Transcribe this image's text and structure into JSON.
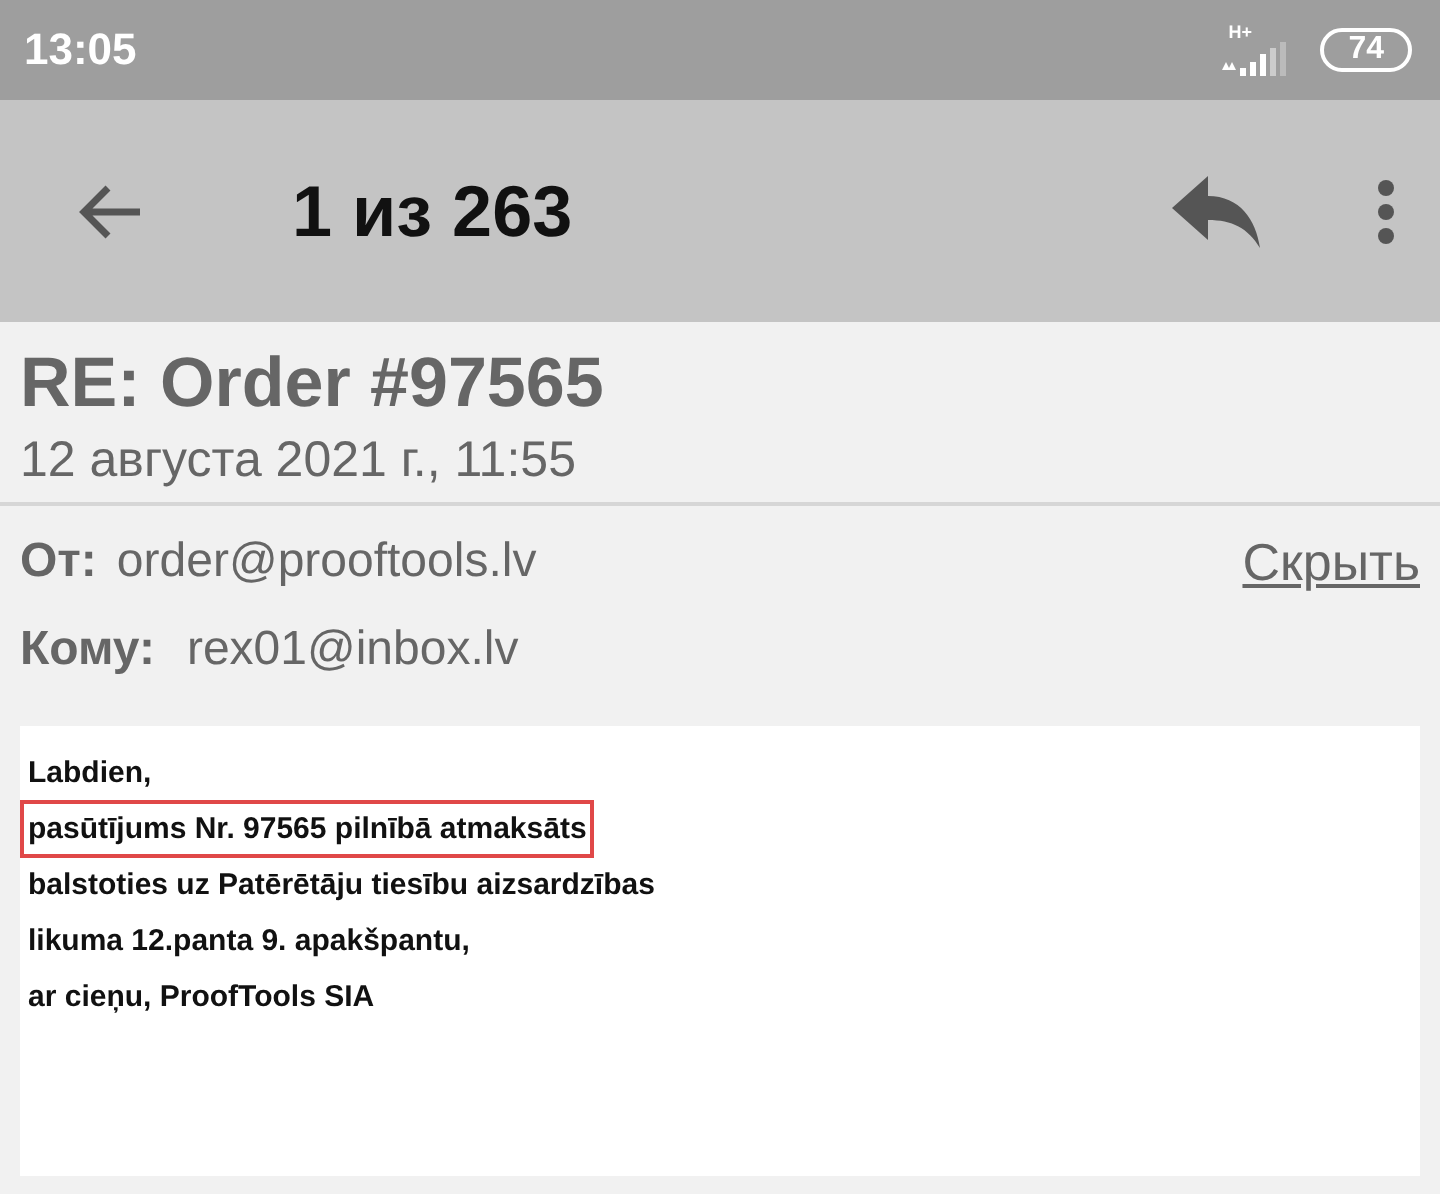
{
  "status_bar": {
    "time": "13:05",
    "network_type": "H+",
    "battery": "74"
  },
  "toolbar": {
    "counter": "1 из 263"
  },
  "message": {
    "subject": "RE: Order #97565",
    "date": "12 августа 2021 г., 11:55",
    "from": {
      "label": "От:",
      "value": "order@prooftools.lv"
    },
    "hide_link": "Скрыть",
    "to": {
      "label": "Кому:",
      "value": "rex01@inbox.lv"
    },
    "body_lines": [
      {
        "text": "Labdien,",
        "highlighted": false
      },
      {
        "text": "pasūtījums Nr. 97565 pilnībā atmaksāts",
        "highlighted": true
      },
      {
        "text": "balstoties uz Patērētāju tiesību aizsardzības",
        "highlighted": false
      },
      {
        "text": "likuma 12.panta 9. apakšpantu,",
        "highlighted": false
      },
      {
        "text": "ar cieņu, ProofTools SIA",
        "highlighted": false
      }
    ]
  }
}
